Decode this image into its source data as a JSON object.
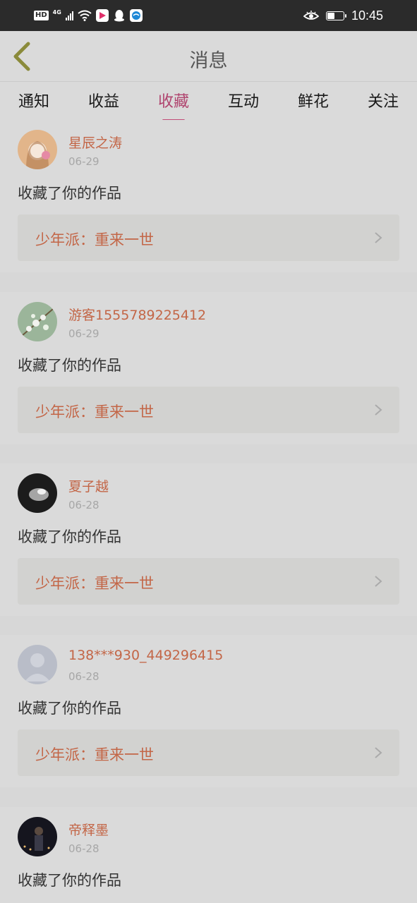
{
  "status_bar": {
    "hd": "HD",
    "network": "4G",
    "time": "10:45",
    "battery_level": 0.5,
    "app_icons": [
      "video-app-icon",
      "qq-icon",
      "browser-icon"
    ]
  },
  "header": {
    "title": "消息"
  },
  "tabs": [
    {
      "label": "通知"
    },
    {
      "label": "收益"
    },
    {
      "label": "收藏"
    },
    {
      "label": "互动"
    },
    {
      "label": "鲜花"
    },
    {
      "label": "关注"
    }
  ],
  "active_tab": "收藏",
  "colors": {
    "accent": "#b0456f",
    "username": "#c36647"
  },
  "messages": [
    {
      "username": "星辰之涛",
      "date": "06-29",
      "action": "收藏了你的作品",
      "work_title": "少年派：重来一世",
      "avatar": "anime-girl-avatar"
    },
    {
      "username": "游客1555789225412",
      "date": "06-29",
      "action": "收藏了你的作品",
      "work_title": "少年派：重来一世",
      "avatar": "flower-branch-avatar"
    },
    {
      "username": "夏子越",
      "date": "06-28",
      "action": "收藏了你的作品",
      "work_title": "少年派：重来一世",
      "avatar": "dark-glow-avatar"
    },
    {
      "username": "138***930_449296415",
      "date": "06-28",
      "action": "收藏了你的作品",
      "work_title": "少年派：重来一世",
      "avatar": "default-user-avatar"
    },
    {
      "username": "帝释墨",
      "date": "06-28",
      "action": "收藏了你的作品",
      "avatar": "night-city-avatar"
    }
  ]
}
